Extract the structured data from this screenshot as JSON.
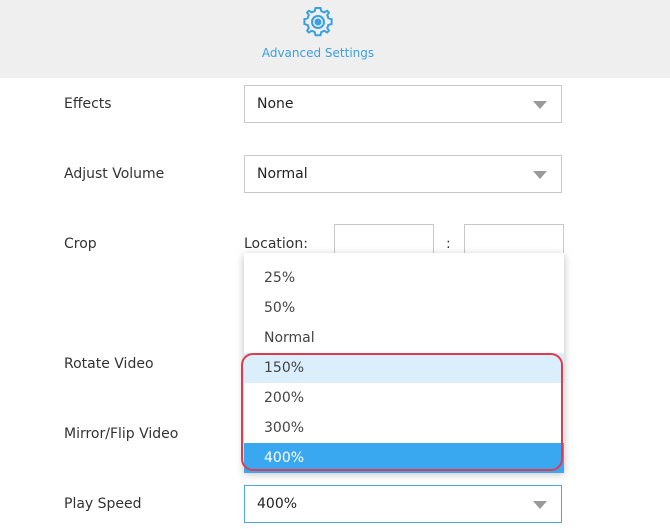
{
  "header": {
    "title": "Advanced Settings",
    "icon": "gear-icon"
  },
  "fields": {
    "effects": {
      "label": "Effects",
      "value": "None"
    },
    "adjust_volume": {
      "label": "Adjust Volume",
      "value": "Normal"
    },
    "crop": {
      "label": "Crop",
      "location_label": "Location:",
      "separator": ":"
    },
    "rotate_video": {
      "label": "Rotate Video"
    },
    "mirror_flip": {
      "label": "Mirror/Flip Video"
    },
    "play_speed": {
      "label": "Play Speed",
      "value": "400%"
    }
  },
  "speed_dropdown": {
    "options": [
      "25%",
      "50%",
      "Normal",
      "150%",
      "200%",
      "300%",
      "400%"
    ],
    "hovered": "150%",
    "selected": "400%"
  },
  "colors": {
    "accent": "#3aa0e0",
    "selected_bg": "#3aa8f0",
    "hover_bg": "#daeefb",
    "highlight_border": "#e03a4f"
  }
}
